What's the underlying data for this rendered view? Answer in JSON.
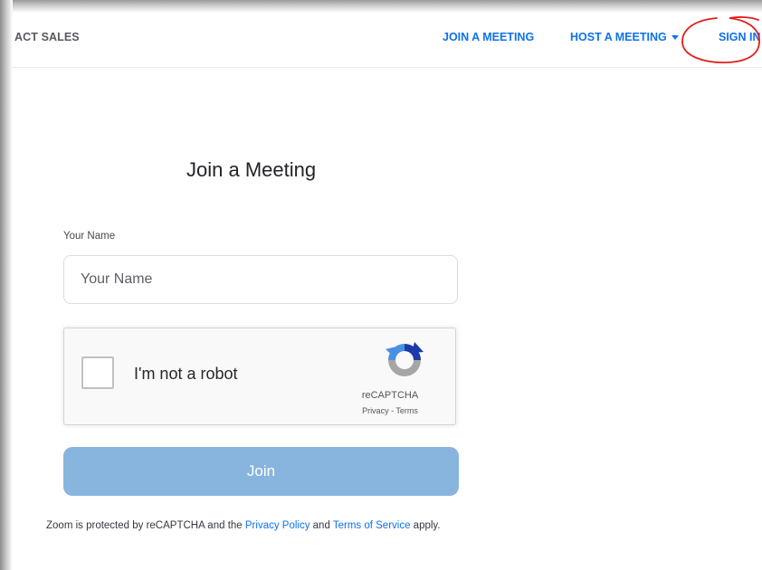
{
  "navbar": {
    "brand": "ACT SALES",
    "join_meeting": "JOIN A MEETING",
    "host_meeting": "HOST A MEETING",
    "sign_in": "SIGN IN"
  },
  "page": {
    "title": "Join a Meeting",
    "name_label": "Your Name",
    "name_placeholder": "Your Name",
    "join_button": "Join"
  },
  "recaptcha": {
    "checkbox_label": "I'm not a robot",
    "brand": "reCAPTCHA",
    "privacy": "Privacy",
    "separator": " - ",
    "terms": "Terms"
  },
  "footer": {
    "text_before": "Zoom is protected by reCAPTCHA and the ",
    "privacy_link": "Privacy Policy",
    "text_middle": " and ",
    "terms_link": "Terms of Service",
    "text_after": " apply."
  },
  "colors": {
    "link": "#0e72ed",
    "join_button": "#88b5de",
    "annotation": "#e0201a"
  },
  "icons": {
    "host_dropdown": "caret-down-icon",
    "recaptcha_logo": "recaptcha-logo-icon",
    "annotation": "red-circle-annotation"
  }
}
